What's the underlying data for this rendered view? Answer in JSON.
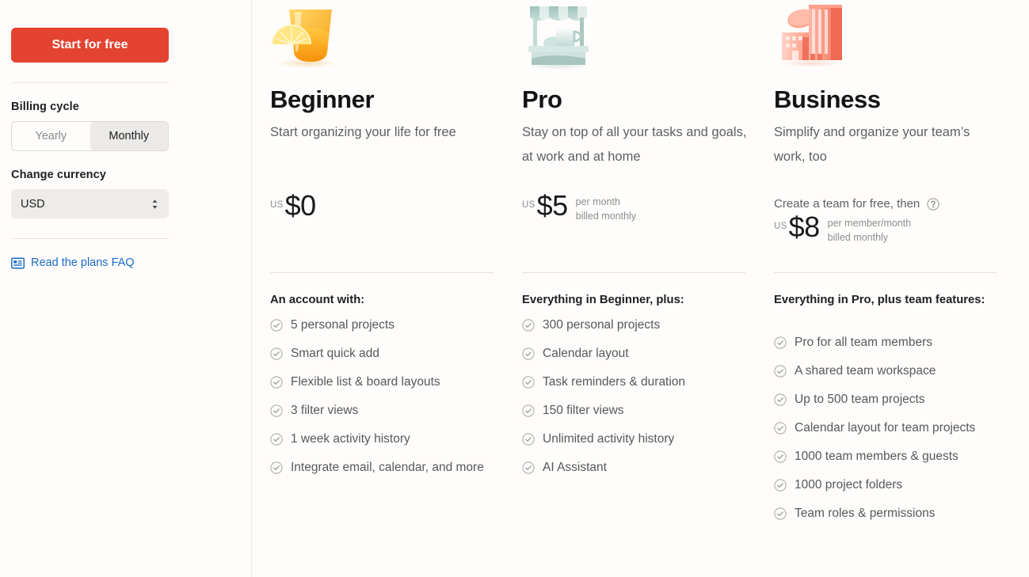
{
  "sidebar": {
    "cta_label": "Start for free",
    "billing_cycle_label": "Billing cycle",
    "billing_options": [
      {
        "label": "Yearly",
        "selected": false
      },
      {
        "label": "Monthly",
        "selected": true
      }
    ],
    "currency_label": "Change currency",
    "currency_value": "USD",
    "faq_link": "Read the plans FAQ",
    "faq_icon": "article-icon",
    "cta_color": "#e44332",
    "link_color": "#1b6ac9"
  },
  "plans": [
    {
      "art_icon": "orange-juice-glass-icon",
      "name": "Beginner",
      "tagline": "Start organizing your life for free",
      "pretext": "",
      "currency_prefix": "US",
      "amount": "$0",
      "per_line1": "",
      "per_line2": "",
      "features_heading": "An account with:",
      "features": [
        "5 personal projects",
        "Smart quick add",
        "Flexible list & board layouts",
        "3 filter views",
        "1 week activity history",
        "Integrate email, calendar, and more"
      ]
    },
    {
      "art_icon": "lemonade-stand-icon",
      "name": "Pro",
      "tagline": "Stay on top of all your tasks and goals, at work and at home",
      "pretext": "",
      "currency_prefix": "US",
      "amount": "$5",
      "per_line1": "per month",
      "per_line2": "billed monthly",
      "features_heading": "Everything in Beginner, plus:",
      "features": [
        "300 personal projects",
        "Calendar layout",
        "Task reminders & duration",
        "150 filter views",
        "Unlimited activity history",
        "AI Assistant"
      ]
    },
    {
      "art_icon": "city-buildings-icon",
      "name": "Business",
      "tagline": "Simplify and organize your team’s work, too",
      "pretext": "Create a team for free, then",
      "currency_prefix": "US",
      "amount": "$8",
      "per_line1": "per member/month",
      "per_line2": "billed monthly",
      "features_heading": "Everything in Pro, plus team features:",
      "features": [
        "Pro for all team members",
        "A shared team workspace",
        "Up to 500 team projects",
        "Calendar layout for team projects",
        "1000 team members & guests",
        "1000 project folders",
        "Team roles & permissions"
      ]
    }
  ]
}
